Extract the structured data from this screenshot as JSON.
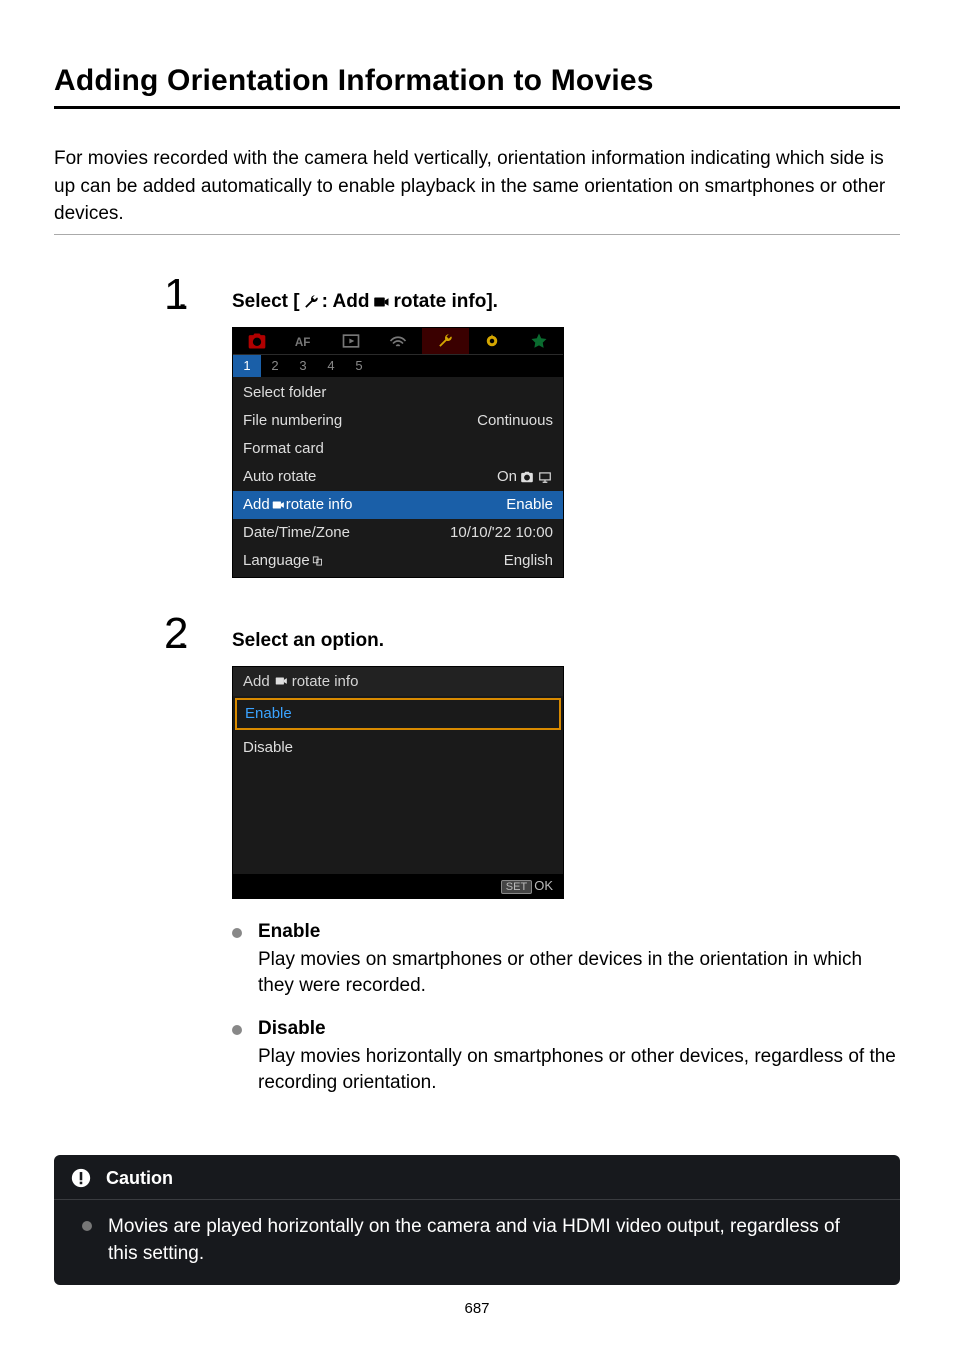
{
  "page": {
    "title": "Adding Orientation Information to Movies",
    "intro": "For movies recorded with the camera held vertically, orientation information indicating which side is up can be added automatically to enable playback in the same orientation on smartphones or other devices.",
    "footer_page": "687"
  },
  "steps": [
    {
      "num": "1",
      "title_before": "Select [",
      "title_mid": ": Add ",
      "title_after": " rotate info].",
      "menu": {
        "subtabs": [
          "1",
          "2",
          "3",
          "4",
          "5"
        ],
        "rows": [
          {
            "label": "Select folder",
            "value": ""
          },
          {
            "label": "File numbering",
            "value": "Continuous"
          },
          {
            "label": "Format card",
            "value": ""
          },
          {
            "label": "Auto rotate",
            "value": "On",
            "value_suffix_icons": true
          },
          {
            "label": "Add ",
            "label_has_icon": true,
            "label_after": " rotate info",
            "value": "Enable",
            "selected": true
          },
          {
            "label": "Date/Time/Zone",
            "value": "10/10/'22 10:00"
          },
          {
            "label": "Language",
            "label_lang_icon": true,
            "value": "English"
          }
        ]
      }
    },
    {
      "num": "2",
      "title": "Select an option.",
      "option_screen": {
        "header_before": "Add ",
        "header_after": " rotate info",
        "options": [
          {
            "label": "Enable",
            "selected": true
          },
          {
            "label": "Disable"
          }
        ],
        "footer": "SET",
        "footer_ok": "OK"
      },
      "bullets": [
        {
          "title": "Enable",
          "text": "Play movies on smartphones or other devices in the orientation in which they were recorded."
        },
        {
          "title": "Disable",
          "text": "Play movies horizontally on smartphones or other devices, regardless of the recording orientation."
        }
      ]
    }
  ],
  "caution": {
    "title": "Caution",
    "text": "Movies are played horizontally on the camera and via HDMI video output, regardless of this setting."
  }
}
